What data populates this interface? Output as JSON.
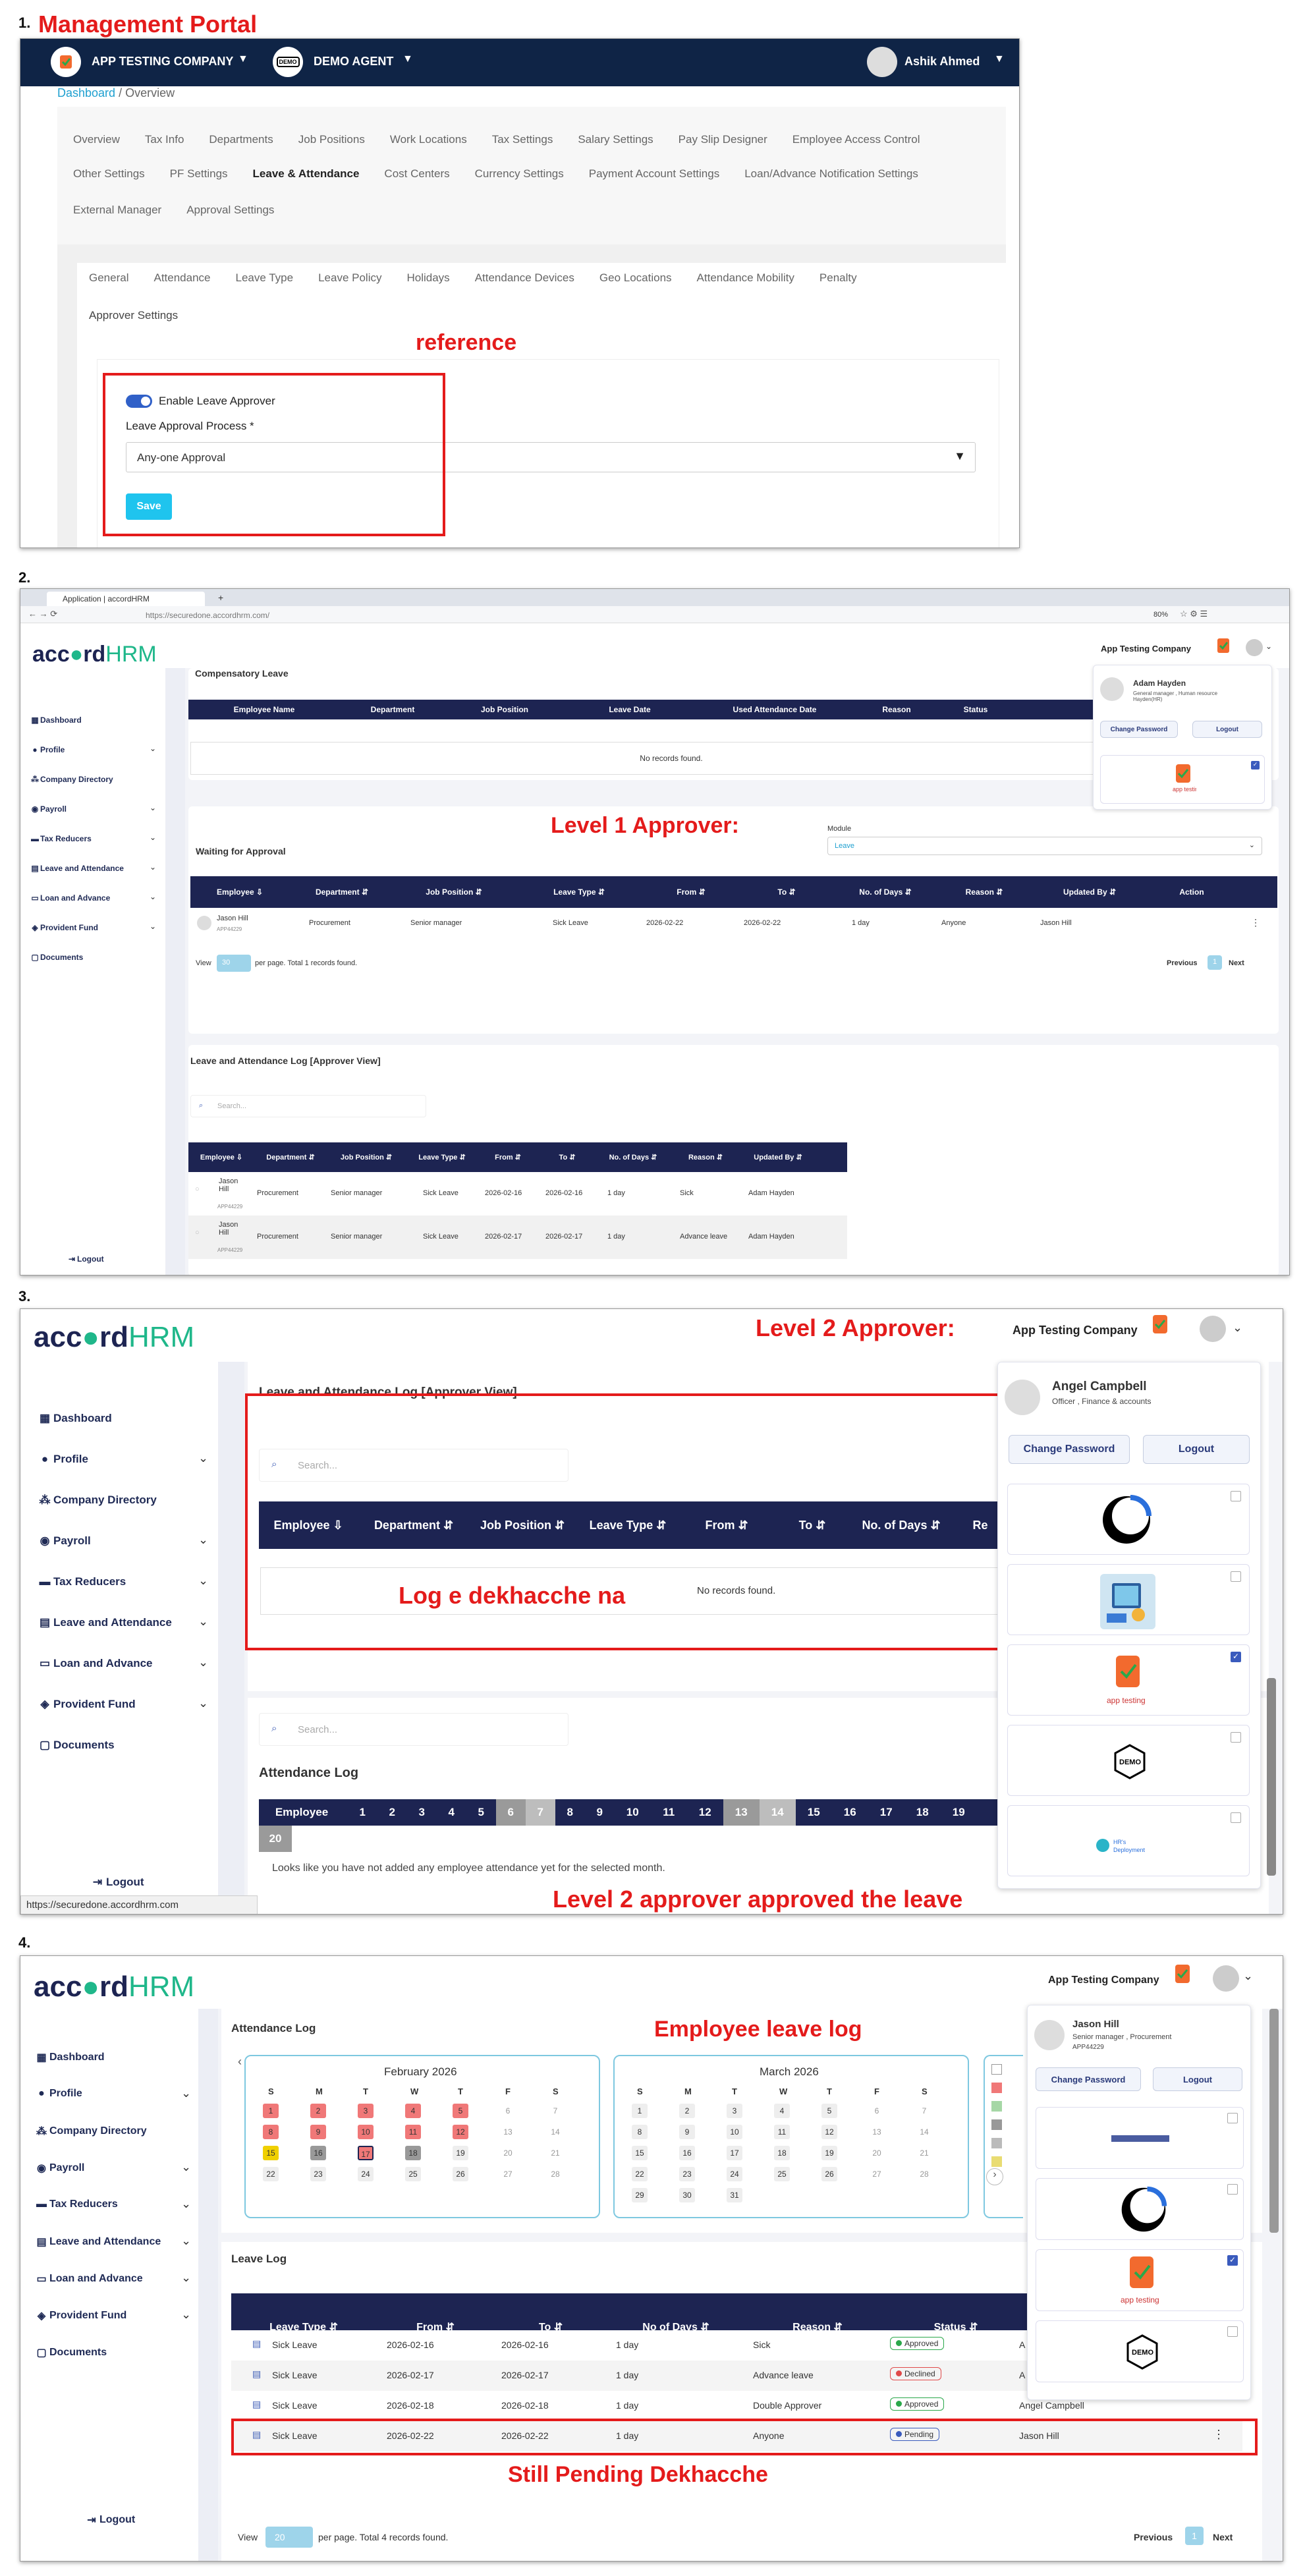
{
  "section1": {
    "number": "1.",
    "heading": "Management Portal",
    "company": "APP TESTING COMPANY",
    "agent": "DEMO AGENT",
    "agent_logo": "DEMO",
    "user": "Ashik Ahmed",
    "breadcrumb_link": "Dashboard",
    "breadcrumb_sep": " / ",
    "breadcrumb_current": "Overview",
    "settings_tabs_row1": [
      "Overview",
      "Tax Info",
      "Departments",
      "Job Positions",
      "Work Locations",
      "Tax Settings",
      "Salary Settings",
      "Pay Slip Designer",
      "Employee Access Control"
    ],
    "settings_tabs_row2": [
      "Other Settings",
      "PF Settings",
      "Leave & Attendance",
      "Cost Centers",
      "Currency Settings",
      "Payment Account Settings",
      "Loan/Advance Notification Settings"
    ],
    "settings_tabs_row3": [
      "External Manager",
      "Approval Settings"
    ],
    "leave_tabs": [
      "General",
      "Attendance",
      "Leave Type",
      "Leave Policy",
      "Holidays",
      "Attendance Devices",
      "Geo Locations",
      "Attendance Mobility",
      "Penalty"
    ],
    "leave_tabs_row2": [
      "Approver Settings"
    ],
    "annotation": "reference",
    "toggle_label": "Enable Leave Approver",
    "process_label": "Leave Approval Process *",
    "process_value": "Any-one Approval",
    "save": "Save"
  },
  "section2": {
    "number": "2.",
    "browser_tab": "Application | accordHRM",
    "url": "https://securedone.accordhrm.com/",
    "zoom": "80%",
    "brand_a": "acc",
    "brand_b": "rd",
    "brand_c": "HRM",
    "company": "App Testing Company",
    "sidebar": [
      "Dashboard",
      "Profile",
      "Company Directory",
      "Payroll",
      "Tax Reducers",
      "Leave and Attendance",
      "Loan and Advance",
      "Provident Fund",
      "Documents"
    ],
    "logout": "Logout",
    "comp_leave_title": "Compensatory Leave",
    "comp_headers": [
      "Employee Name",
      "Department",
      "Job Position",
      "Leave Date",
      "Used Attendance Date",
      "Reason",
      "Status"
    ],
    "no_records": "No records found.",
    "annotation": "Level 1 Approver:",
    "module_label": "Module",
    "module_value": "Leave",
    "waiting_title": "Waiting for Approval",
    "wait_headers": [
      "Employee ⇩",
      "Department ⇵",
      "Job Position ⇵",
      "Leave Type ⇵",
      "From ⇵",
      "To ⇵",
      "No. of Days ⇵",
      "Reason ⇵",
      "Updated By ⇵",
      "Action"
    ],
    "wait_row": [
      "Jason Hill",
      "Procurement",
      "Senior manager",
      "Sick Leave",
      "2026-02-22",
      "2026-02-22",
      "1 day",
      "Anyone",
      "Jason Hill"
    ],
    "emp_id": "APP44229",
    "view_label": "View",
    "per_page": "30",
    "per_page_text": "per page. Total 1 records found.",
    "prev": "Previous",
    "page": "1",
    "next": "Next",
    "log_title": "Leave and Attendance Log [Approver View]",
    "search_placeholder": "Search...",
    "log_headers": [
      "Employee ⇩",
      "Department ⇵",
      "Job Position ⇵",
      "Leave Type ⇵",
      "From ⇵",
      "To ⇵",
      "No. of Days ⇵",
      "Reason ⇵",
      "Updated By ⇵"
    ],
    "log_rows": [
      [
        "Jason Hill",
        "Procurement",
        "Senior manager",
        "Sick Leave",
        "2026-02-16",
        "2026-02-16",
        "1 day",
        "Sick",
        "Adam Hayden"
      ],
      [
        "Jason Hill",
        "Procurement",
        "Senior manager",
        "Sick Leave",
        "2026-02-17",
        "2026-02-17",
        "1 day",
        "Advance leave",
        "Adam Hayden"
      ]
    ],
    "profile_name": "Adam Hayden",
    "profile_role": "General manager , Human resource Hayden(HR)",
    "change_password": "Change Password",
    "logout_btn": "Logout"
  },
  "section3": {
    "number": "3.",
    "annotation_title": "Level 2 Approver:",
    "company": "App Testing Company",
    "log_title": "Leave and Attendance Log [Approver View]",
    "search_placeholder": "Search...",
    "headers": [
      "Employee ⇩",
      "Department ⇵",
      "Job Position ⇵",
      "Leave Type ⇵",
      "From ⇵",
      "To ⇵",
      "No. of Days ⇵",
      "Re"
    ],
    "no_records": "No records found.",
    "annotation_log": "Log e dekhacche na",
    "attendance_title": "Attendance Log",
    "att_employee": "Employee",
    "att_days": [
      "1",
      "2",
      "3",
      "4",
      "5",
      "6",
      "7",
      "8",
      "9",
      "10",
      "11",
      "12",
      "13",
      "14",
      "15",
      "16",
      "17",
      "18",
      "19",
      "20"
    ],
    "att_empty": "Looks like you have not added any employee attendance yet for the selected month.",
    "annotation_bottom": "Level 2 approver approved  the leave",
    "status_url": "https://securedone.accordhrm.com",
    "profile_name": "Angel Campbell",
    "profile_role": "Officer , Finance & accounts",
    "change_password": "Change Password",
    "logout_btn": "Logout",
    "logout": "Logout"
  },
  "section4": {
    "number": "4.",
    "annotation_title": "Employee leave log",
    "company": "App Testing Company",
    "attendance_title": "Attendance Log",
    "feb_title": "February 2026",
    "mar_title": "March 2026",
    "weekdays": [
      "S",
      "M",
      "T",
      "W",
      "T",
      "F",
      "S"
    ],
    "feb_days": [
      "1",
      "2",
      "3",
      "4",
      "5",
      "6",
      "7",
      "8",
      "9",
      "10",
      "11",
      "12",
      "13",
      "14",
      "15",
      "16",
      "17",
      "18",
      "19",
      "20",
      "21",
      "22",
      "23",
      "24",
      "25",
      "26",
      "27",
      "28"
    ],
    "mar_days": [
      "1",
      "2",
      "3",
      "4",
      "5",
      "6",
      "7",
      "8",
      "9",
      "10",
      "11",
      "12",
      "13",
      "14",
      "15",
      "16",
      "17",
      "18",
      "19",
      "20",
      "21",
      "22",
      "23",
      "24",
      "25",
      "26",
      "27",
      "28",
      "29",
      "30",
      "31"
    ],
    "leave_log_title": "Leave Log",
    "headers": [
      "Leave Type ⇵",
      "From ⇵",
      "To ⇵",
      "No of Days ⇵",
      "Reason ⇵",
      "Status ⇵"
    ],
    "rows": [
      {
        "type": "Sick Leave",
        "from": "2026-02-16",
        "to": "2026-02-16",
        "days": "1 day",
        "reason": "Sick",
        "status": "Approved",
        "by": "A"
      },
      {
        "type": "Sick Leave",
        "from": "2026-02-17",
        "to": "2026-02-17",
        "days": "1 day",
        "reason": "Advance leave",
        "status": "Declined",
        "by": "A"
      },
      {
        "type": "Sick Leave",
        "from": "2026-02-18",
        "to": "2026-02-18",
        "days": "1 day",
        "reason": "Double Approver",
        "status": "Approved",
        "by": "Angel Campbell"
      },
      {
        "type": "Sick Leave",
        "from": "2026-02-22",
        "to": "2026-02-22",
        "days": "1 day",
        "reason": "Anyone",
        "status": "Pending",
        "by": "Jason Hill"
      }
    ],
    "annotation_bottom": "Still Pending Dekhacche",
    "view_label": "View",
    "per_page": "20",
    "per_page_text": "per page. Total 4 records found.",
    "prev": "Previous",
    "page": "1",
    "next": "Next",
    "profile_name": "Jason Hill",
    "profile_role": "Senior manager , Procurement",
    "profile_id": "APP44229",
    "change_password": "Change Password",
    "logout_btn": "Logout",
    "logout": "Logout"
  },
  "colors": {
    "red": "#e41b1b",
    "navy": "#1d2452",
    "topbar": "#0f2446",
    "accent": "#1fc4ee"
  }
}
